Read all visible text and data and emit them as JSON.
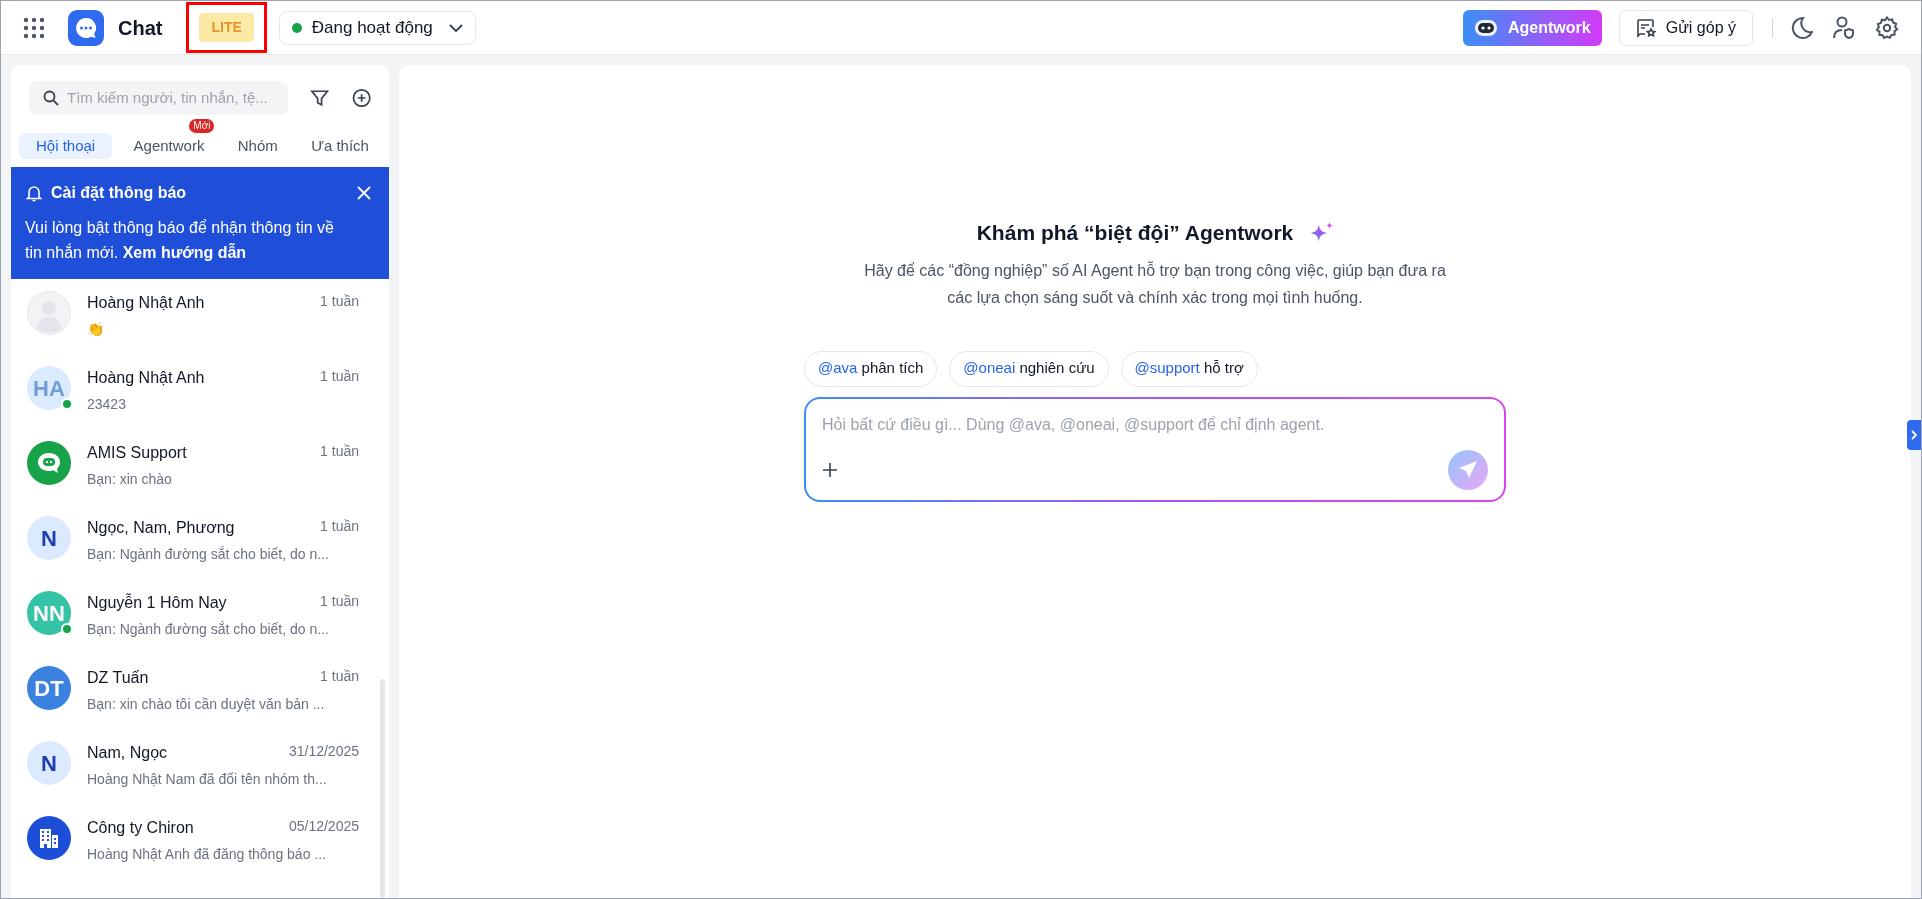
{
  "topbar": {
    "app_title": "Chat",
    "plan_badge": "LITE",
    "status": {
      "label": "Đang hoạt động",
      "online": true
    },
    "agentwork_button": "Agentwork",
    "feedback_button": "Gửi góp ý"
  },
  "sidebar": {
    "search": {
      "placeholder": "Tìm kiếm người, tin nhắn, tệ..."
    },
    "tabs": [
      {
        "label": "Hội thoại",
        "selected": true
      },
      {
        "label": "Agentwork",
        "selected": false,
        "badge": "Mới"
      },
      {
        "label": "Nhóm",
        "selected": false
      },
      {
        "label": "Ưa thích",
        "selected": false
      }
    ],
    "banner": {
      "title": "Cài đặt thông báo",
      "message": "Vui lòng bật thông báo để nhận thông tin về tin nhắn mới.",
      "link": "Xem hướng dẫn"
    },
    "conversations": [
      {
        "name": "Hoàng Nhật Anh",
        "preview": "👏",
        "time": "1 tuần",
        "avatar": {
          "kind": "placeholder"
        },
        "online": false
      },
      {
        "name": "Hoàng Nhật Anh",
        "preview": "23423",
        "time": "1 tuần",
        "avatar": {
          "kind": "initials",
          "text": "HA",
          "color": "#dbeafe"
        },
        "online": true
      },
      {
        "name": "AMIS Support",
        "preview": "Bạn: xin chào",
        "time": "1 tuần",
        "avatar": {
          "kind": "bot",
          "color": "#16a34a"
        },
        "online": false
      },
      {
        "name": "Ngọc, Nam, Phương",
        "preview": "Bạn: Ngành đường sắt cho biết, do n...",
        "time": "1 tuần",
        "avatar": {
          "kind": "initials",
          "text": "N",
          "color": "#dbeafe"
        },
        "online": false
      },
      {
        "name": "Nguyễn 1 Hôm Nay",
        "preview": "Bạn: Ngành đường sắt cho biết, do n...",
        "time": "1 tuần",
        "avatar": {
          "kind": "initials",
          "text": "NN",
          "color": "#34c3a4"
        },
        "online": true
      },
      {
        "name": "DZ Tuấn",
        "preview": "Bạn: xin chào tôi cần duyệt văn bản ...",
        "time": "1 tuần",
        "avatar": {
          "kind": "initials",
          "text": "DT",
          "color": "#3b82e0"
        },
        "online": false
      },
      {
        "name": "Nam, Ngọc",
        "preview": "Hoàng Nhật Nam đã đổi tên nhóm th...",
        "time": "31/12/2025",
        "avatar": {
          "kind": "initials",
          "text": "N",
          "color": "#dbeafe"
        },
        "online": false
      },
      {
        "name": "Công ty Chiron",
        "preview": "Hoàng Nhật Anh đã đăng thông báo ...",
        "time": "05/12/2025",
        "avatar": {
          "kind": "building",
          "color": "#1d4ed8"
        },
        "online": false
      }
    ]
  },
  "main": {
    "heading": "Khám phá “biệt đội” Agentwork",
    "description": "Hãy để các “đồng nghiệp” số AI Agent hỗ trợ bạn trong công việc, giúp bạn đưa ra các lựa chọn sáng suốt và chính xác trong mọi tình huống.",
    "suggestions": [
      {
        "mention": "@ava",
        "text": "phân tích"
      },
      {
        "mention": "@oneai",
        "text": "nghiên cứu"
      },
      {
        "mention": "@support",
        "text": "hỗ trợ"
      }
    ],
    "prompt": {
      "placeholder": "Hỏi bất cứ điều gì... Dùng @ava, @oneai, @support để chỉ định agent."
    }
  }
}
